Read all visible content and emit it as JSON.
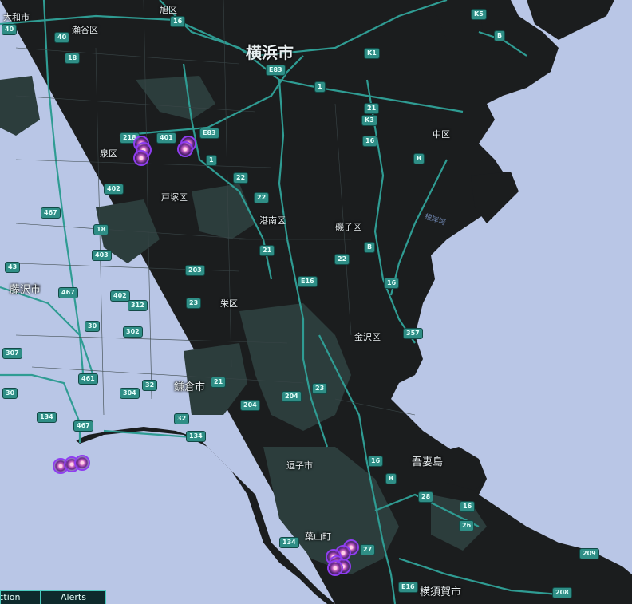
{
  "map": {
    "colors": {
      "water": "#b9c6e6",
      "land": "#1b1d1e",
      "green": "#2c3d3c",
      "road": "#2f9c93",
      "marker": "#8f3df0"
    },
    "places": [
      {
        "id": "owada",
        "label": "大和市"
      },
      {
        "id": "seya",
        "label": "瀬谷区"
      },
      {
        "id": "asahi",
        "label": "旭区"
      },
      {
        "id": "yokohama",
        "label": "横浜市"
      },
      {
        "id": "izumi",
        "label": "泉区"
      },
      {
        "id": "naka",
        "label": "中区"
      },
      {
        "id": "totsuka",
        "label": "戸塚区"
      },
      {
        "id": "konan",
        "label": "港南区"
      },
      {
        "id": "isogo",
        "label": "磯子区"
      },
      {
        "id": "fujisawa",
        "label": "藤沢市"
      },
      {
        "id": "sakae",
        "label": "栄区"
      },
      {
        "id": "kanazawa",
        "label": "金沢区"
      },
      {
        "id": "kamakura",
        "label": "鎌倉市"
      },
      {
        "id": "zushi",
        "label": "逗子市"
      },
      {
        "id": "azuma",
        "label": "吾妻島"
      },
      {
        "id": "hayama",
        "label": "葉山町"
      },
      {
        "id": "yokosuka",
        "label": "横須賀市"
      }
    ],
    "water_labels": [
      {
        "id": "negishi",
        "label": "根岸湾"
      }
    ],
    "shields": [
      "40",
      "40",
      "16",
      "18",
      "K5",
      "B",
      "K1",
      "E83",
      "1",
      "21",
      "K3",
      "218",
      "401",
      "E83",
      "16",
      "B",
      "1",
      "22",
      "22",
      "402",
      "467",
      "18",
      "403",
      "43",
      "467",
      "402",
      "312",
      "23",
      "203",
      "21",
      "E16",
      "22",
      "B",
      "16",
      "357",
      "30",
      "302",
      "307",
      "461",
      "32",
      "21",
      "304",
      "30",
      "134",
      "467",
      "204",
      "23",
      "204",
      "32",
      "134",
      "16",
      "B",
      "28",
      "16",
      "26",
      "134",
      "27",
      "209",
      "E16",
      "208"
    ],
    "alert_clusters": [
      {
        "id": "izumi",
        "count": 3
      },
      {
        "id": "totsuka-east",
        "count": 2
      },
      {
        "id": "shonan-coast",
        "count": 3
      },
      {
        "id": "hayama-south",
        "count": 6
      }
    ]
  },
  "tabs": [
    {
      "id": "action",
      "label": "Action"
    },
    {
      "id": "alerts",
      "label": "Alerts"
    }
  ]
}
